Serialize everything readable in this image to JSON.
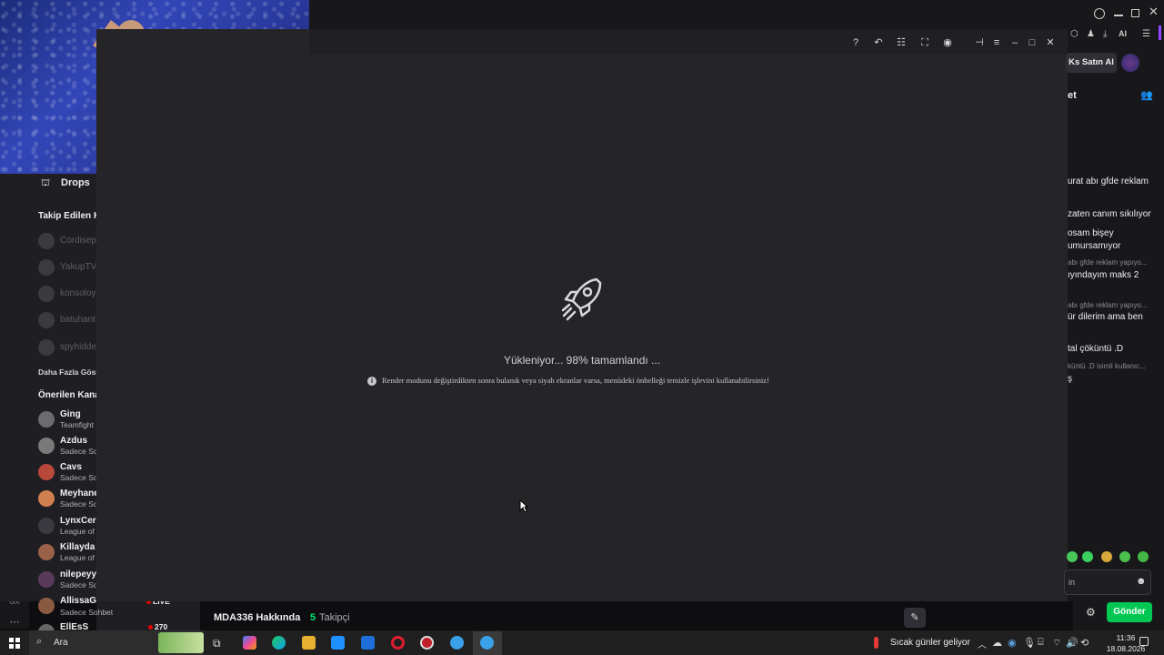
{
  "sidebar": {
    "drops_label": "Drops",
    "followed_heading": "Takip Edilen K",
    "followed": [
      "Cordisep",
      "YakupTV",
      "konsoloy",
      "batuhant",
      "spyhidde"
    ],
    "show_more": "Daha Fazla Göste",
    "recommended_heading": "Önerilen Kana",
    "recommended": [
      {
        "name": "Ging",
        "category": "Teamfight"
      },
      {
        "name": "Azdus",
        "category": "Sadece So"
      },
      {
        "name": "Cavs",
        "category": "Sadece So"
      },
      {
        "name": "Meyhane",
        "category": "Sadece So"
      },
      {
        "name": "LynxCere",
        "category": "League of"
      },
      {
        "name": "Killayda",
        "category": "League of"
      },
      {
        "name": "nilepeyy",
        "category": "Sadece So"
      },
      {
        "name": "AllissaG",
        "category": "Sadece Sohbet",
        "status": "LIVE"
      },
      {
        "name": "EllEsS",
        "viewers": "270"
      }
    ]
  },
  "player": {
    "loading_text": "Yükleniyor... 98% tamamlandı ...",
    "info_text": "Render modunu değiştirdikten sonra bulanık veya siyah ekranlar varsa, menüdeki önbelleği temizle işlevini kullanabilirsiniz!"
  },
  "header": {
    "buy_button": "Ks Satın Al",
    "chat_title": "et",
    "ai_label": "AI"
  },
  "chat": {
    "messages": [
      {
        "kind": "msg",
        "text": "urat abı gfde reklam"
      },
      {
        "kind": "msg",
        "text": "zaten canım sıkılıyor"
      },
      {
        "kind": "msg",
        "text": "osam bişey"
      },
      {
        "kind": "msg",
        "text": "umursamıyor"
      },
      {
        "kind": "reply",
        "text": "abı gfde reklam yapıyo..."
      },
      {
        "kind": "msg",
        "text": "ıyındayım maks 2"
      },
      {
        "kind": "reply",
        "text": "abı gfde reklam yapıyo..."
      },
      {
        "kind": "msg",
        "text": "ür dilerim ama ben"
      },
      {
        "kind": "msg",
        "text": "tal çöküntü .D"
      },
      {
        "kind": "reply",
        "text": "küntü .D isimli kullanıc..."
      },
      {
        "kind": "msg",
        "text": "ş"
      }
    ],
    "input_placeholder": "in",
    "send_button": "Gönder"
  },
  "about": {
    "title": "MDA336 Hakkında",
    "followers_count": "5",
    "followers_label": "Takipçi"
  },
  "taskbar": {
    "search_label": "Ara",
    "weather": "Sıcak günler geliyor",
    "time": "11:36",
    "date": "18.08.2026"
  },
  "colors": {
    "accent": "#9147ff",
    "live": "#eb0400",
    "send_button": "#00c853",
    "followers_count": "#00e676"
  }
}
